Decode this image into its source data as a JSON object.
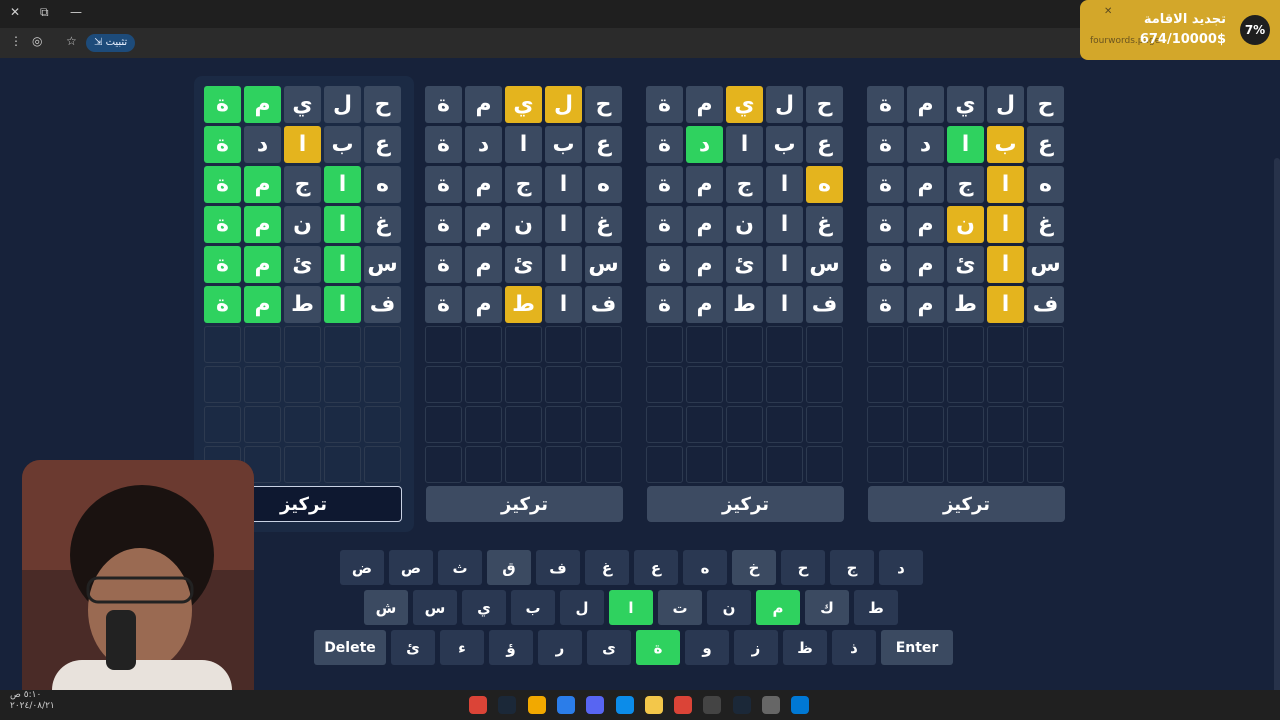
{
  "browser": {
    "install_label": "تثبيت",
    "close_icon": "close-icon",
    "restore_icon": "restore-icon",
    "minimize_icon": "minimize-icon"
  },
  "notification": {
    "title": "تجديد الاقامة",
    "amount": "674/10000$",
    "url": "fourwords.page",
    "percent": "7%"
  },
  "boards": [
    {
      "focused": true,
      "focus_label": "تركيز",
      "rows": [
        [
          {
            "l": "ح",
            "s": "absent"
          },
          {
            "l": "ل",
            "s": "absent"
          },
          {
            "l": "ي",
            "s": "absent"
          },
          {
            "l": "م",
            "s": "correct"
          },
          {
            "l": "ة",
            "s": "correct"
          }
        ],
        [
          {
            "l": "ع",
            "s": "absent"
          },
          {
            "l": "ب",
            "s": "absent"
          },
          {
            "l": "ا",
            "s": "present"
          },
          {
            "l": "د",
            "s": "absent"
          },
          {
            "l": "ة",
            "s": "correct"
          }
        ],
        [
          {
            "l": "ه",
            "s": "absent"
          },
          {
            "l": "ا",
            "s": "correct"
          },
          {
            "l": "ج",
            "s": "absent"
          },
          {
            "l": "م",
            "s": "correct"
          },
          {
            "l": "ة",
            "s": "correct"
          }
        ],
        [
          {
            "l": "غ",
            "s": "absent"
          },
          {
            "l": "ا",
            "s": "correct"
          },
          {
            "l": "ن",
            "s": "absent"
          },
          {
            "l": "م",
            "s": "correct"
          },
          {
            "l": "ة",
            "s": "correct"
          }
        ],
        [
          {
            "l": "س",
            "s": "absent"
          },
          {
            "l": "ا",
            "s": "correct"
          },
          {
            "l": "ئ",
            "s": "absent"
          },
          {
            "l": "م",
            "s": "correct"
          },
          {
            "l": "ة",
            "s": "correct"
          }
        ],
        [
          {
            "l": "ف",
            "s": "absent"
          },
          {
            "l": "ا",
            "s": "correct"
          },
          {
            "l": "ط",
            "s": "absent"
          },
          {
            "l": "م",
            "s": "correct"
          },
          {
            "l": "ة",
            "s": "correct"
          }
        ]
      ]
    },
    {
      "focused": false,
      "focus_label": "تركيز",
      "rows": [
        [
          {
            "l": "ح",
            "s": "absent"
          },
          {
            "l": "ل",
            "s": "present"
          },
          {
            "l": "ي",
            "s": "present"
          },
          {
            "l": "م",
            "s": "absent"
          },
          {
            "l": "ة",
            "s": "absent"
          }
        ],
        [
          {
            "l": "ع",
            "s": "absent"
          },
          {
            "l": "ب",
            "s": "absent"
          },
          {
            "l": "ا",
            "s": "absent"
          },
          {
            "l": "د",
            "s": "absent"
          },
          {
            "l": "ة",
            "s": "absent"
          }
        ],
        [
          {
            "l": "ه",
            "s": "absent"
          },
          {
            "l": "ا",
            "s": "absent"
          },
          {
            "l": "ج",
            "s": "absent"
          },
          {
            "l": "م",
            "s": "absent"
          },
          {
            "l": "ة",
            "s": "absent"
          }
        ],
        [
          {
            "l": "غ",
            "s": "absent"
          },
          {
            "l": "ا",
            "s": "absent"
          },
          {
            "l": "ن",
            "s": "absent"
          },
          {
            "l": "م",
            "s": "absent"
          },
          {
            "l": "ة",
            "s": "absent"
          }
        ],
        [
          {
            "l": "س",
            "s": "absent"
          },
          {
            "l": "ا",
            "s": "absent"
          },
          {
            "l": "ئ",
            "s": "absent"
          },
          {
            "l": "م",
            "s": "absent"
          },
          {
            "l": "ة",
            "s": "absent"
          }
        ],
        [
          {
            "l": "ف",
            "s": "absent"
          },
          {
            "l": "ا",
            "s": "absent"
          },
          {
            "l": "ط",
            "s": "present"
          },
          {
            "l": "م",
            "s": "absent"
          },
          {
            "l": "ة",
            "s": "absent"
          }
        ]
      ]
    },
    {
      "focused": false,
      "focus_label": "تركيز",
      "rows": [
        [
          {
            "l": "ح",
            "s": "absent"
          },
          {
            "l": "ل",
            "s": "absent"
          },
          {
            "l": "ي",
            "s": "present"
          },
          {
            "l": "م",
            "s": "absent"
          },
          {
            "l": "ة",
            "s": "absent"
          }
        ],
        [
          {
            "l": "ع",
            "s": "absent"
          },
          {
            "l": "ب",
            "s": "absent"
          },
          {
            "l": "ا",
            "s": "absent"
          },
          {
            "l": "د",
            "s": "correct"
          },
          {
            "l": "ة",
            "s": "absent"
          }
        ],
        [
          {
            "l": "ه",
            "s": "present"
          },
          {
            "l": "ا",
            "s": "absent"
          },
          {
            "l": "ج",
            "s": "absent"
          },
          {
            "l": "م",
            "s": "absent"
          },
          {
            "l": "ة",
            "s": "absent"
          }
        ],
        [
          {
            "l": "غ",
            "s": "absent"
          },
          {
            "l": "ا",
            "s": "absent"
          },
          {
            "l": "ن",
            "s": "absent"
          },
          {
            "l": "م",
            "s": "absent"
          },
          {
            "l": "ة",
            "s": "absent"
          }
        ],
        [
          {
            "l": "س",
            "s": "absent"
          },
          {
            "l": "ا",
            "s": "absent"
          },
          {
            "l": "ئ",
            "s": "absent"
          },
          {
            "l": "م",
            "s": "absent"
          },
          {
            "l": "ة",
            "s": "absent"
          }
        ],
        [
          {
            "l": "ف",
            "s": "absent"
          },
          {
            "l": "ا",
            "s": "absent"
          },
          {
            "l": "ط",
            "s": "absent"
          },
          {
            "l": "م",
            "s": "absent"
          },
          {
            "l": "ة",
            "s": "absent"
          }
        ]
      ]
    },
    {
      "focused": false,
      "focus_label": "تركيز",
      "rows": [
        [
          {
            "l": "ح",
            "s": "absent"
          },
          {
            "l": "ل",
            "s": "absent"
          },
          {
            "l": "ي",
            "s": "absent"
          },
          {
            "l": "م",
            "s": "absent"
          },
          {
            "l": "ة",
            "s": "absent"
          }
        ],
        [
          {
            "l": "ع",
            "s": "absent"
          },
          {
            "l": "ب",
            "s": "present"
          },
          {
            "l": "ا",
            "s": "correct"
          },
          {
            "l": "د",
            "s": "absent"
          },
          {
            "l": "ة",
            "s": "absent"
          }
        ],
        [
          {
            "l": "ه",
            "s": "absent"
          },
          {
            "l": "ا",
            "s": "present"
          },
          {
            "l": "ج",
            "s": "absent"
          },
          {
            "l": "م",
            "s": "absent"
          },
          {
            "l": "ة",
            "s": "absent"
          }
        ],
        [
          {
            "l": "غ",
            "s": "absent"
          },
          {
            "l": "ا",
            "s": "present"
          },
          {
            "l": "ن",
            "s": "present"
          },
          {
            "l": "م",
            "s": "absent"
          },
          {
            "l": "ة",
            "s": "absent"
          }
        ],
        [
          {
            "l": "س",
            "s": "absent"
          },
          {
            "l": "ا",
            "s": "present"
          },
          {
            "l": "ئ",
            "s": "absent"
          },
          {
            "l": "م",
            "s": "absent"
          },
          {
            "l": "ة",
            "s": "absent"
          }
        ],
        [
          {
            "l": "ف",
            "s": "absent"
          },
          {
            "l": "ا",
            "s": "present"
          },
          {
            "l": "ط",
            "s": "absent"
          },
          {
            "l": "م",
            "s": "absent"
          },
          {
            "l": "ة",
            "s": "absent"
          }
        ]
      ]
    }
  ],
  "keyboard": {
    "rows": [
      [
        {
          "k": "د",
          "s": "unused"
        },
        {
          "k": "ج",
          "s": "unused"
        },
        {
          "k": "ح",
          "s": "unused"
        },
        {
          "k": "خ",
          "s": "used"
        },
        {
          "k": "ه",
          "s": "unused"
        },
        {
          "k": "ع",
          "s": "unused"
        },
        {
          "k": "غ",
          "s": "unused"
        },
        {
          "k": "ف",
          "s": "unused"
        },
        {
          "k": "ق",
          "s": "used"
        },
        {
          "k": "ث",
          "s": "unused"
        },
        {
          "k": "ص",
          "s": "unused"
        },
        {
          "k": "ض",
          "s": "unused"
        }
      ],
      [
        {
          "k": "ط",
          "s": "unused"
        },
        {
          "k": "ك",
          "s": "used"
        },
        {
          "k": "م",
          "s": "correct"
        },
        {
          "k": "ن",
          "s": "unused"
        },
        {
          "k": "ت",
          "s": "used"
        },
        {
          "k": "ا",
          "s": "correct"
        },
        {
          "k": "ل",
          "s": "unused"
        },
        {
          "k": "ب",
          "s": "unused"
        },
        {
          "k": "ي",
          "s": "unused"
        },
        {
          "k": "س",
          "s": "unused"
        },
        {
          "k": "ش",
          "s": "used"
        }
      ],
      [
        {
          "k": "Enter",
          "s": "wide"
        },
        {
          "k": "ذ",
          "s": "unused"
        },
        {
          "k": "ظ",
          "s": "unused"
        },
        {
          "k": "ز",
          "s": "unused"
        },
        {
          "k": "و",
          "s": "unused"
        },
        {
          "k": "ة",
          "s": "correct"
        },
        {
          "k": "ى",
          "s": "unused"
        },
        {
          "k": "ر",
          "s": "unused"
        },
        {
          "k": "ؤ",
          "s": "unused"
        },
        {
          "k": "ء",
          "s": "unused"
        },
        {
          "k": "ئ",
          "s": "unused"
        },
        {
          "k": "Delete",
          "s": "wide"
        }
      ]
    ]
  },
  "taskbar_icons": [
    "chrome-icon",
    "steam-icon",
    "rockstar-icon",
    "app-icon",
    "discord-icon",
    "edge-icon",
    "folder-icon",
    "chrome-icon",
    "obs-icon",
    "steam-icon",
    "settings-icon",
    "windows-icon"
  ]
}
